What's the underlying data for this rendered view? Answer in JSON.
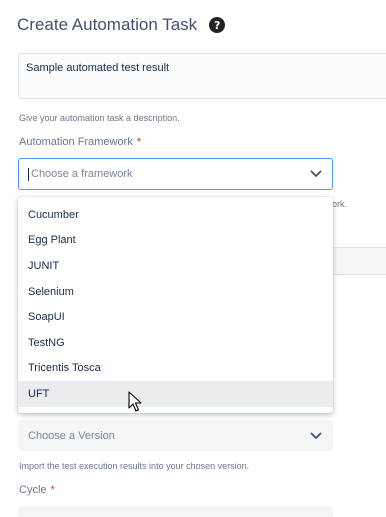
{
  "page": {
    "title": "Create Automation Task",
    "help_icon": "?"
  },
  "description": {
    "value": "Sample automated test result",
    "hint": "Give your automation task a description."
  },
  "framework": {
    "label": "Automation Framework",
    "required_mark": "*",
    "placeholder": "Choose a framework",
    "hint_fragment": "ork.",
    "options": [
      "Cucumber",
      "Egg Plant",
      "JUNIT",
      "Selenium",
      "SoapUI",
      "TestNG",
      "Tricentis Tosca",
      "UFT"
    ],
    "highlighted_option": "UFT"
  },
  "version": {
    "placeholder": "Choose a Version",
    "hint": "Import the test execution results into your chosen version."
  },
  "cycle": {
    "label": "Cycle",
    "required_mark": "*"
  },
  "colors": {
    "focus_border": "#4c9aff",
    "required": "#de350b",
    "highlight_bg": "#ebecf0",
    "field_bg": "#f4f5f7"
  }
}
